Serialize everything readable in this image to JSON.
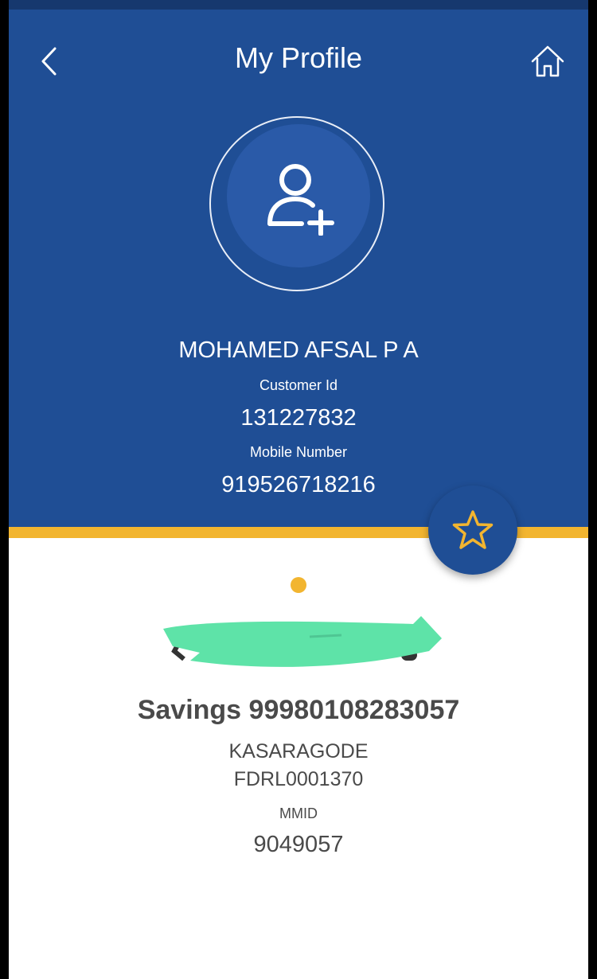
{
  "header": {
    "title": "My Profile",
    "back_icon": "chevron-left-icon",
    "home_icon": "home-icon"
  },
  "profile": {
    "avatar_icon": "add-user-icon",
    "name": "MOHAMED AFSAL P A",
    "customer_id_label": "Customer Id",
    "customer_id": "131227832",
    "mobile_label": "Mobile Number",
    "mobile": "919526718216",
    "favorite_icon": "star-icon"
  },
  "account": {
    "title": "Savings 99980108283057",
    "branch": "KASARAGODE",
    "ifsc": "FDRL0001370",
    "mmid_label": "MMID",
    "mmid": "9049057"
  },
  "colors": {
    "primary_blue": "#1f4e95",
    "accent_yellow": "#f2b530",
    "redaction_green": "#5ee3a8"
  }
}
